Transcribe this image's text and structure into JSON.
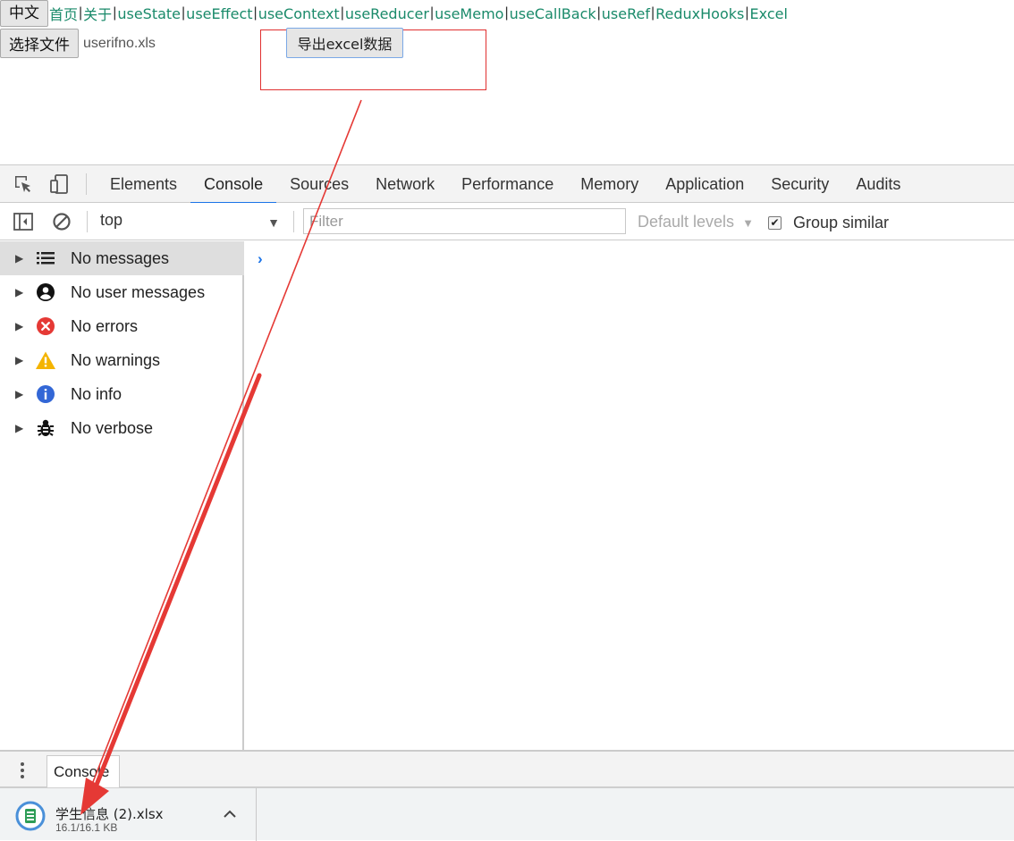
{
  "page": {
    "lang_button": "中文",
    "nav_links": [
      "首页",
      "关于",
      "useState",
      "useEffect",
      "useContext",
      "useReducer",
      "useMemo",
      "useCallBack",
      "useRef",
      "ReduxHooks",
      "Excel"
    ],
    "nav_separator": "|",
    "choose_file_button": "选择文件",
    "chosen_file": "userifno.xls",
    "export_button": "导出excel数据"
  },
  "devtools": {
    "tabs": [
      "Elements",
      "Console",
      "Sources",
      "Network",
      "Performance",
      "Memory",
      "Application",
      "Security",
      "Audits"
    ],
    "active_tab": "Console",
    "toolbar": {
      "context": "top",
      "filter_placeholder": "Filter",
      "levels": "Default levels",
      "group_similar": "Group similar",
      "group_similar_checked": true
    },
    "sidebar": [
      {
        "label": "No messages",
        "icon": "list-icon",
        "selected": true
      },
      {
        "label": "No user messages",
        "icon": "user-icon",
        "selected": false
      },
      {
        "label": "No errors",
        "icon": "error-icon",
        "selected": false
      },
      {
        "label": "No warnings",
        "icon": "warning-icon",
        "selected": false
      },
      {
        "label": "No info",
        "icon": "info-icon",
        "selected": false
      },
      {
        "label": "No verbose",
        "icon": "bug-icon",
        "selected": false
      }
    ],
    "prompt_symbol": "›",
    "drawer_tab": "Console"
  },
  "download": {
    "file_name": "学生信息 (2).xlsx",
    "size": "16.1/16.1 KB"
  },
  "colors": {
    "link": "#1a8a6a",
    "accent": "#1a73e8",
    "annotation": "#e53935",
    "error": "#e53935",
    "warning": "#f4b400",
    "info": "#3367d6"
  }
}
